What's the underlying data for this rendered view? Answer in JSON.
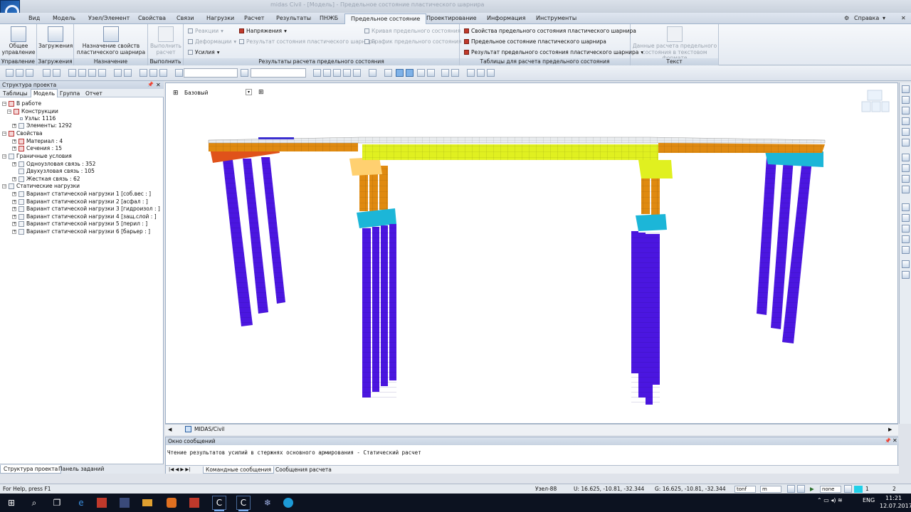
{
  "window": {
    "title": "midas Civil - [Модель] - Предельное состояние пластического шарнира"
  },
  "menu_tabs": [
    "Вид",
    "Модель",
    "Узел/Элемент",
    "Свойства",
    "Связи",
    "Нагрузки",
    "Расчет",
    "Результаты",
    "ПНЖБ",
    "Предельное состояние",
    "Проектирование",
    "Информация",
    "Инструменты"
  ],
  "active_tab_index": 9,
  "help_label": "Справка",
  "ribbon": {
    "control": {
      "btn1": "Общее управление",
      "group": "Управление"
    },
    "loads": {
      "btn1": "Загружения",
      "group": "Загружения"
    },
    "assign": {
      "btn1": "Назначение свойств пластического шарнира",
      "group": "Назначение"
    },
    "run": {
      "btn1": "Выполнить расчет",
      "group": "Выполнить"
    },
    "results": {
      "group": "Результаты расчета предельного состояния",
      "reactions": "Реакции",
      "stresses": "Напряжения",
      "deform": "Деформации",
      "forces": "Усилия",
      "curve": "Кривая предельного состояния",
      "plastic_state": "Результат состояния пластического шарнира",
      "graph": "График предельного состояния"
    },
    "tables": {
      "group": "Таблицы для расчета предельного состояния",
      "t1": "Свойства предельного состояния пластического шарнира",
      "t2": "Предельное состояние пластического шарнира",
      "t3": "Результат предельного состояния пластического шарнира"
    },
    "text": {
      "group": "Текст",
      "btn1": "Данные расчета предельного состояния в текстовом формате"
    }
  },
  "left_panel": {
    "title": "Структура проекта",
    "tabs": [
      "Таблицы",
      "Модель",
      "Группа",
      "Отчет"
    ],
    "active_tab": 1,
    "tree": [
      {
        "label": "В работе",
        "level": 0
      },
      {
        "label": "Конструкции",
        "level": 1
      },
      {
        "label": "Узлы: 1116",
        "level": 2
      },
      {
        "label": "Элементы: 1292",
        "level": 2
      },
      {
        "label": "Свойства",
        "level": 1
      },
      {
        "label": "Материал : 4",
        "level": 2
      },
      {
        "label": "Сечения : 15",
        "level": 2
      },
      {
        "label": "Граничные условия",
        "level": 1
      },
      {
        "label": "Одноузловая связь : 352",
        "level": 2
      },
      {
        "label": "Двухузловая связь : 105",
        "level": 2
      },
      {
        "label": "Жесткая связь : 62",
        "level": 2
      },
      {
        "label": "Статические нагрузки",
        "level": 1
      },
      {
        "label": "Вариант статической нагрузки 1 [соб.вес : ]",
        "level": 2
      },
      {
        "label": "Вариант статической нагрузки 2 [асфал : ]",
        "level": 2
      },
      {
        "label": "Вариант статической нагрузки 3 [гидроизол : ]",
        "level": 2
      },
      {
        "label": "Вариант статической нагрузки 4 [защ.слой : ]",
        "level": 2
      },
      {
        "label": "Вариант статической нагрузки 5 [перил : ]",
        "level": 2
      },
      {
        "label": "Вариант статической нагрузки 6 [барьер : ]",
        "level": 2
      }
    ],
    "bottom_tabs": [
      "Структура проекта",
      "Панель заданий"
    ]
  },
  "viewport": {
    "view_name": "Базовый",
    "doc_tab": "MIDAS/Civil"
  },
  "messages": {
    "title": "Окно сообщений",
    "text": "Чтение результатов усилий в стержнях основного армирования - Статический расчет",
    "prompt": ">>",
    "tabs": [
      "Командные сообщения",
      "Сообщения расчета"
    ]
  },
  "status": {
    "help": "For Help, press F1",
    "node": "Узел-88",
    "u_coords": "U: 16.625, -10.81, -32.344",
    "g_coords": "G: 16.625, -10.81, -32.344",
    "force_unit": "tonf",
    "length_unit": "m",
    "none": "none",
    "page1": "1",
    "page2": "2"
  },
  "taskbar": {
    "lang": "ENG",
    "time": "11:21",
    "date": "12.07.2017"
  },
  "colors": {
    "pier": "#4b16e0",
    "cap": "#1cb6d8",
    "deck_side": "#e08a10",
    "deck_mid": "#e0f020",
    "pedestal": "#ffd070"
  }
}
